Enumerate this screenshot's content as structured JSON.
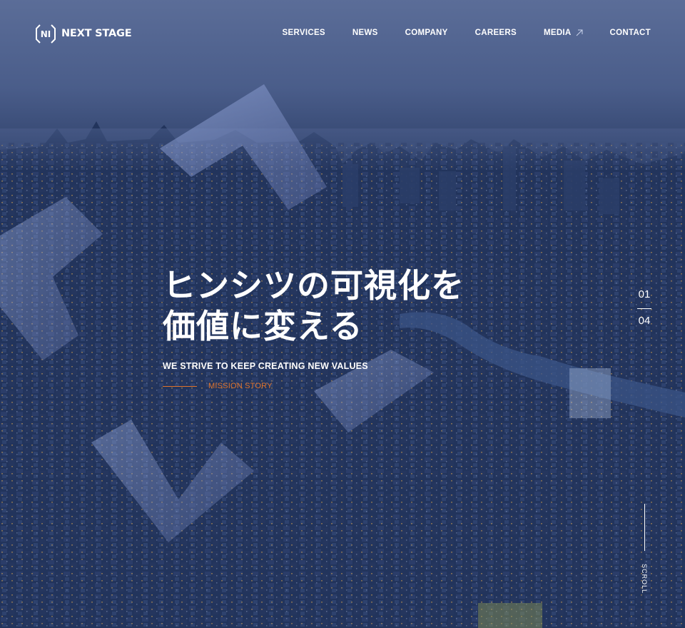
{
  "brand": {
    "name": "NEXT STAGE",
    "mark_letters": "NI"
  },
  "nav": {
    "items": [
      {
        "label": "SERVICES"
      },
      {
        "label": "NEWS"
      },
      {
        "label": "COMPANY"
      },
      {
        "label": "CAREERS"
      },
      {
        "label": "MEDIA"
      },
      {
        "label": "CONTACT"
      }
    ]
  },
  "hero": {
    "headline_line1": "ヒンシツの可視化を",
    "headline_line2": "価値に変える",
    "subcopy": "WE STRIVE TO KEEP CREATING NEW VALUES",
    "link_label": "MISSION STORY"
  },
  "slider": {
    "current": "01",
    "total": "04"
  },
  "scroll": {
    "label": "SCROLL"
  },
  "colors": {
    "accent": "#e0742b",
    "text": "#ffffff",
    "sky": "#5b6d98",
    "city": "#1c2d52"
  },
  "icons": {
    "media_external": "arrow-up-right-icon",
    "logo": "next-stage-logo-icon"
  }
}
